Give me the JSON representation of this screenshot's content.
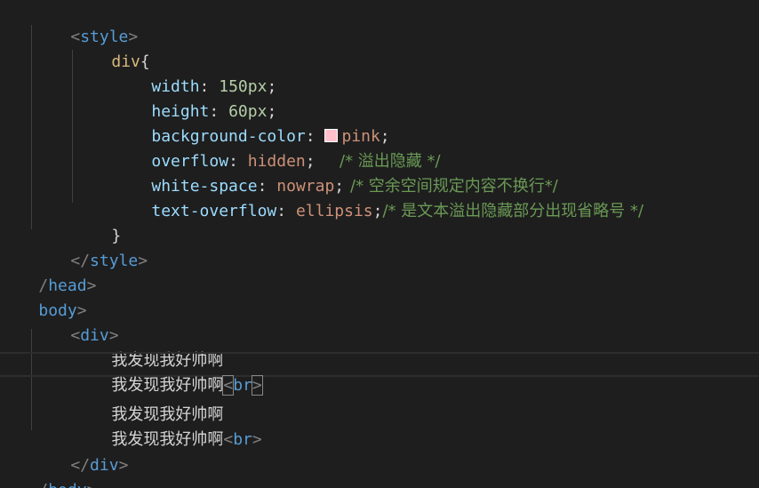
{
  "colors": {
    "background": "#1e1e1e",
    "tag": "#569cd6",
    "punct": "#808080",
    "selector": "#d7ba7d",
    "property": "#9cdcfe",
    "number": "#b5cea8",
    "value": "#ce9178",
    "comment": "#6a9955",
    "text": "#d4d4d4",
    "swatch_pink": "#ffc0cb"
  },
  "code": {
    "style_open": {
      "lt": "<",
      "name": "style",
      "gt": ">"
    },
    "selector": "div",
    "open_brace": "{",
    "close_brace": "}",
    "decls": [
      {
        "prop": "width",
        "colon": ": ",
        "num": "150",
        "unit": "px",
        "semi": ";",
        "comment": ""
      },
      {
        "prop": "height",
        "colon": ": ",
        "num": "60",
        "unit": "px",
        "semi": ";",
        "comment": ""
      },
      {
        "prop": "background-color",
        "colon": ": ",
        "value": "pink",
        "semi": ";",
        "comment": ""
      },
      {
        "prop": "overflow",
        "colon": ": ",
        "value": "hidden",
        "semi": ";",
        "comment": "/* 溢出隐藏 */"
      },
      {
        "prop": "white-space",
        "colon": ": ",
        "value": "nowrap",
        "semi": ";",
        "comment": "/* 空余空间规定内容不换行*/"
      },
      {
        "prop": "text-overflow",
        "colon": ": ",
        "value": "ellipsis",
        "semi": ";",
        "comment": "/* 是文本溢出隐藏部分出现省略号 */"
      }
    ],
    "style_close": {
      "lt": "</",
      "name": "style",
      "gt": ">"
    },
    "head_close": {
      "lt": "/",
      "name": "head",
      "gt": ">"
    },
    "body_open": {
      "name": "body",
      "gt": ">"
    },
    "div_open": {
      "lt": "<",
      "name": "div",
      "gt": ">"
    },
    "div_text": "我发现我好帅啊",
    "br": {
      "lt": "<",
      "name": "br",
      "gt": ">"
    },
    "div_close": {
      "lt": "</",
      "name": "div",
      "gt": ">"
    },
    "body_close": {
      "lt": "/",
      "name": "body",
      "gt": ">"
    }
  }
}
